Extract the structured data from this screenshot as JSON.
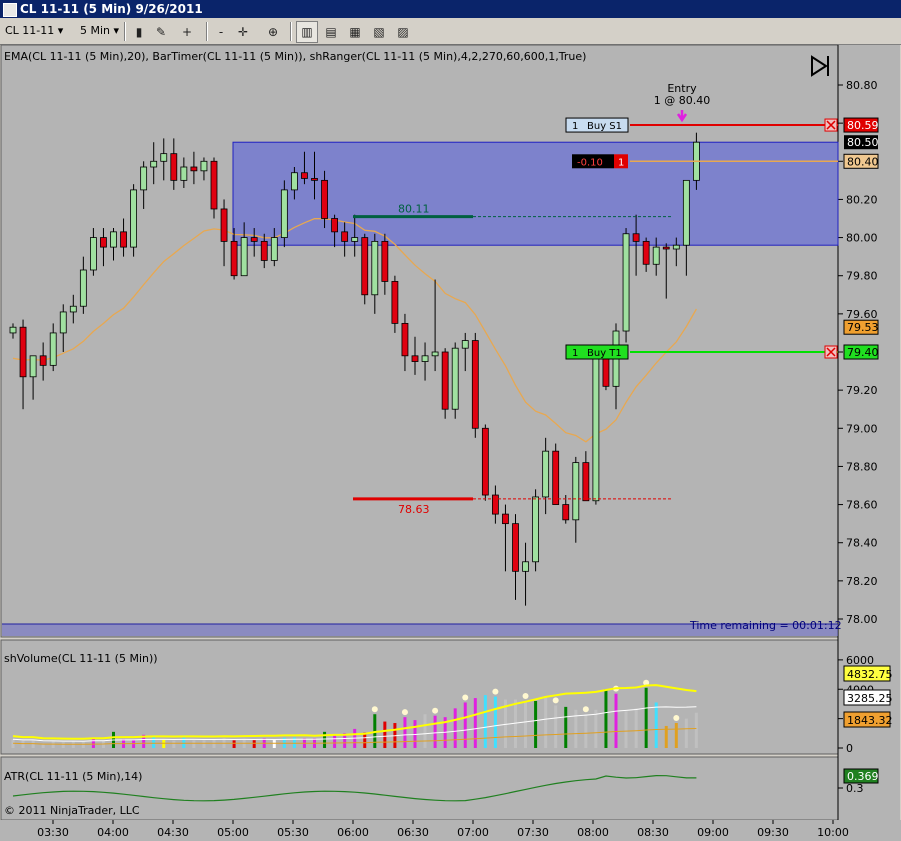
{
  "window": {
    "title": "CL 11-11 (5 Min)  9/26/2011"
  },
  "toolbar": {
    "instrument": "CL 11-11",
    "interval": "5 Min"
  },
  "chart_data": {
    "type": "candlestick",
    "indicator_label": "EMA(CL 11-11 (5 Min),20), BarTimer(CL 11-11 (5 Min)), shRanger(CL 11-11 (5 Min),4,2,270,60,600,1,True)",
    "price_ticks": [
      "80.80",
      "80.60",
      "80.40",
      "80.20",
      "80.00",
      "79.80",
      "79.60",
      "79.40",
      "79.20",
      "79.00",
      "78.80",
      "78.60",
      "78.40",
      "78.20",
      "78.00"
    ],
    "price_ylim": [
      77.92,
      80.92
    ],
    "time_ticks": [
      "03:30",
      "04:00",
      "04:30",
      "05:00",
      "05:30",
      "06:00",
      "06:30",
      "07:00",
      "07:30",
      "08:00",
      "08:30",
      "09:00",
      "09:30",
      "10:00"
    ],
    "candles": [
      [
        79.5,
        79.55,
        79.47,
        79.53
      ],
      [
        79.53,
        79.57,
        79.1,
        79.27
      ],
      [
        79.27,
        79.38,
        79.15,
        79.38
      ],
      [
        79.38,
        79.45,
        79.25,
        79.33
      ],
      [
        79.33,
        79.55,
        79.3,
        79.5
      ],
      [
        79.5,
        79.65,
        79.4,
        79.61
      ],
      [
        79.61,
        79.7,
        79.55,
        79.64
      ],
      [
        79.64,
        79.9,
        79.6,
        79.83
      ],
      [
        79.83,
        80.05,
        79.8,
        80.0
      ],
      [
        80.0,
        80.05,
        79.85,
        79.95
      ],
      [
        79.95,
        80.05,
        79.88,
        80.03
      ],
      [
        80.03,
        80.1,
        79.9,
        79.95
      ],
      [
        79.95,
        80.28,
        79.9,
        80.25
      ],
      [
        80.25,
        80.4,
        80.15,
        80.37
      ],
      [
        80.37,
        80.5,
        80.28,
        80.4
      ],
      [
        80.4,
        80.52,
        80.3,
        80.44
      ],
      [
        80.44,
        80.52,
        80.25,
        80.3
      ],
      [
        80.3,
        80.42,
        80.26,
        80.37
      ],
      [
        80.37,
        80.45,
        80.28,
        80.35
      ],
      [
        80.35,
        80.42,
        80.3,
        80.4
      ],
      [
        80.4,
        80.42,
        80.1,
        80.15
      ],
      [
        80.15,
        80.2,
        79.85,
        79.98
      ],
      [
        79.98,
        80.05,
        79.78,
        79.8
      ],
      [
        79.8,
        80.08,
        79.8,
        80.0
      ],
      [
        80.0,
        80.05,
        79.9,
        79.98
      ],
      [
        79.98,
        80.02,
        79.84,
        79.88
      ],
      [
        79.88,
        80.05,
        79.85,
        80.0
      ],
      [
        80.0,
        80.3,
        79.95,
        80.25
      ],
      [
        80.25,
        80.37,
        80.2,
        80.34
      ],
      [
        80.34,
        80.45,
        80.28,
        80.31
      ],
      [
        80.31,
        80.45,
        80.2,
        80.3
      ],
      [
        80.3,
        80.35,
        80.05,
        80.1
      ],
      [
        80.1,
        80.12,
        79.95,
        80.03
      ],
      [
        80.03,
        80.08,
        79.9,
        79.98
      ],
      [
        79.98,
        80.12,
        79.9,
        80.0
      ],
      [
        80.0,
        80.02,
        79.65,
        79.7
      ],
      [
        79.7,
        80.02,
        79.6,
        79.98
      ],
      [
        79.98,
        80.02,
        79.7,
        79.77
      ],
      [
        79.77,
        79.8,
        79.5,
        79.55
      ],
      [
        79.55,
        79.6,
        79.3,
        79.38
      ],
      [
        79.38,
        79.48,
        79.28,
        79.35
      ],
      [
        79.35,
        79.45,
        79.25,
        79.38
      ],
      [
        79.38,
        79.78,
        79.3,
        79.4
      ],
      [
        79.4,
        79.42,
        79.05,
        79.1
      ],
      [
        79.1,
        79.45,
        79.05,
        79.42
      ],
      [
        79.42,
        79.5,
        79.3,
        79.46
      ],
      [
        79.46,
        79.5,
        78.95,
        79.0
      ],
      [
        79.0,
        79.02,
        78.62,
        78.65
      ],
      [
        78.65,
        78.7,
        78.5,
        78.55
      ],
      [
        78.55,
        78.6,
        78.25,
        78.5
      ],
      [
        78.5,
        78.55,
        78.1,
        78.25
      ],
      [
        78.25,
        78.4,
        78.07,
        78.3
      ],
      [
        78.3,
        78.68,
        78.25,
        78.64
      ],
      [
        78.64,
        78.95,
        78.55,
        78.88
      ],
      [
        78.88,
        78.92,
        78.6,
        78.6
      ],
      [
        78.6,
        78.65,
        78.5,
        78.52
      ],
      [
        78.52,
        78.85,
        78.4,
        78.82
      ],
      [
        78.82,
        78.88,
        78.62,
        78.62
      ],
      [
        78.62,
        79.4,
        78.6,
        79.37
      ],
      [
        79.37,
        79.42,
        79.2,
        79.22
      ],
      [
        79.22,
        79.55,
        79.1,
        79.51
      ],
      [
        79.51,
        80.05,
        79.45,
        80.02
      ],
      [
        80.02,
        80.12,
        79.8,
        79.98
      ],
      [
        79.98,
        80.0,
        79.82,
        79.86
      ],
      [
        79.86,
        80.0,
        79.8,
        79.95
      ],
      [
        79.95,
        79.97,
        79.68,
        79.94
      ],
      [
        79.94,
        80.0,
        79.85,
        79.96
      ],
      [
        79.96,
        80.3,
        79.8,
        80.3
      ],
      [
        80.3,
        80.55,
        80.25,
        80.5
      ]
    ],
    "ema_color": "#e8a850",
    "range_box": {
      "top": 80.5,
      "bottom": 79.96,
      "color": "#5f67d8"
    },
    "high_marker": {
      "label": "80.11",
      "price": 80.11,
      "color": "#006040"
    },
    "low_marker": {
      "label": "78.63",
      "price": 78.63,
      "color": "#e00000"
    },
    "entry": {
      "line1": "Entry",
      "line2": "1 @ 80.40"
    },
    "orders": [
      {
        "qty": "1",
        "label": "Buy S1",
        "price_label": "80.59",
        "color": "#e00000"
      },
      {
        "qty": "1",
        "label": "Buy T1",
        "price_label": "79.40",
        "color": "#00d000"
      }
    ],
    "position": {
      "pnl": "-0.10",
      "qty": "1",
      "entry_label": "80.40"
    },
    "last_price": "80.50",
    "ema_value": "79.53",
    "time_remaining": "Time remaining = 00:01:12",
    "volume_panel": {
      "label": "shVolume(CL 11-11 (5 Min))",
      "ticks": [
        "6000",
        "4000",
        "2000",
        "0"
      ],
      "max": 6400,
      "values_labels": [
        "4832.75",
        "3285.25",
        "1843.32"
      ],
      "bars": [
        600,
        500,
        550,
        300,
        480,
        400,
        450,
        420,
        700,
        500,
        1100,
        600,
        560,
        900,
        750,
        560,
        500,
        700,
        520,
        520,
        600,
        650,
        520,
        600,
        530,
        650,
        540,
        700,
        720,
        650,
        650,
        1100,
        860,
        1000,
        1300,
        1050,
        2300,
        1800,
        1700,
        2100,
        1900,
        2300,
        2200,
        2100,
        2700,
        3100,
        3400,
        3600,
        3500,
        3300,
        3300,
        3200,
        3200,
        3500,
        2900,
        2800,
        2600,
        2300,
        2600,
        4000,
        3700,
        2500,
        2700,
        4100,
        3100,
        1500,
        1700,
        2000,
        2400
      ],
      "bar_colors": [
        "#c0c0c0",
        "#c0c0c0",
        "#c0c0c0",
        "#c0c0c0",
        "#c0c0c0",
        "#c0c0c0",
        "#c0c0c0",
        "#c0c0c0",
        "#e020e0",
        "#c0c0c0",
        "#008000",
        "#e020e0",
        "#e020e0",
        "#e020e0",
        "#40e0ff",
        "#ffff00",
        "#c0c0c0",
        "#40e0ff",
        "#c0c0c0",
        "#c0c0c0",
        "#c0c0c0",
        "#c0c0c0",
        "#e00000",
        "#c0c0c0",
        "#e00000",
        "#e020e0",
        "#ffffff",
        "#40e0ff",
        "#40e0ff",
        "#e020e0",
        "#e020e0",
        "#008000",
        "#e020e0",
        "#e020e0",
        "#e020e0",
        "#e00000",
        "#008000",
        "#e00000",
        "#e00000",
        "#e020e0",
        "#e020e0",
        "#c0c0c0",
        "#e020e0",
        "#e020e0",
        "#e020e0",
        "#e020e0",
        "#e020e0",
        "#40e0ff",
        "#40e0ff",
        "#c0c0c0",
        "#c0c0c0",
        "#c0c0c0",
        "#008000",
        "#c0c0c0",
        "#c0c0c0",
        "#008000",
        "#c0c0c0",
        "#c0c0c0",
        "#c0c0c0",
        "#008000",
        "#e020e0",
        "#c0c0c0",
        "#c0c0c0",
        "#008000",
        "#40e0ff",
        "#e0a020",
        "#e0a020",
        "#c0c0c0",
        "#c0c0c0"
      ],
      "ma_yellow_color": "#ffff00",
      "ma_white_color": "#ffffff",
      "ma_orange_color": "#e0a020"
    },
    "atr_panel": {
      "label": "ATR(CL 11-11 (5 Min),14)",
      "value_label": "0.369",
      "tick": "0.3"
    },
    "copyright": "© 2011 NinjaTrader, LLC"
  }
}
